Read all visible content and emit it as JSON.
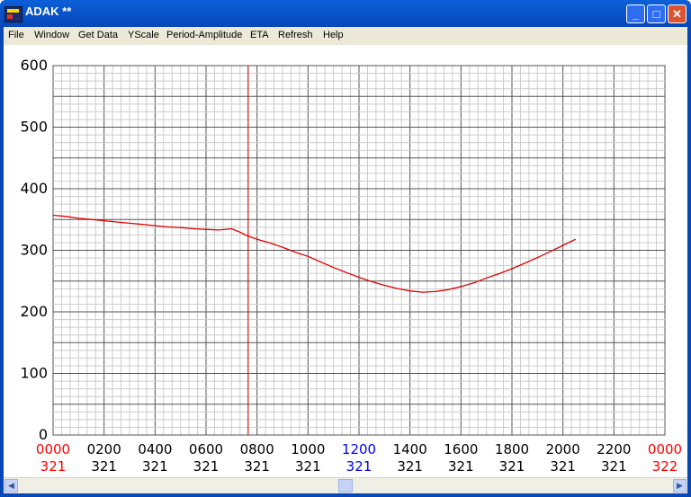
{
  "window": {
    "title": "ADAK **",
    "minimize_label": "_",
    "maximize_label": "□",
    "close_label": "✕"
  },
  "menu": [
    "File",
    "Window",
    "Get Data",
    "YScale",
    "Period-Amplitude",
    "ETA",
    "Refresh",
    "Help"
  ],
  "colors": {
    "titlebar": "#0a5fd8",
    "trace": "#dd0000",
    "cursor": "#dd0000",
    "label_red": "#ff0000",
    "label_blue": "#0000ff",
    "grid_major": "#555555",
    "grid_minor": "#cccccc"
  },
  "chart_data": {
    "type": "line",
    "ylim": [
      0,
      600
    ],
    "ytick_labels": [
      "600",
      "500",
      "400",
      "300",
      "200",
      "100",
      "0"
    ],
    "x_time_labels": [
      {
        "top": "0000",
        "bottom": "321",
        "color": "red"
      },
      {
        "top": "0200",
        "bottom": "321",
        "color": "black"
      },
      {
        "top": "0400",
        "bottom": "321",
        "color": "black"
      },
      {
        "top": "0600",
        "bottom": "321",
        "color": "black"
      },
      {
        "top": "0800",
        "bottom": "321",
        "color": "black"
      },
      {
        "top": "1000",
        "bottom": "321",
        "color": "black"
      },
      {
        "top": "1200",
        "bottom": "321",
        "color": "blue"
      },
      {
        "top": "1400",
        "bottom": "321",
        "color": "black"
      },
      {
        "top": "1600",
        "bottom": "321",
        "color": "black"
      },
      {
        "top": "1800",
        "bottom": "321",
        "color": "black"
      },
      {
        "top": "2000",
        "bottom": "321",
        "color": "black"
      },
      {
        "top": "2200",
        "bottom": "321",
        "color": "black"
      },
      {
        "top": "0000",
        "bottom": "322",
        "color": "red"
      }
    ],
    "x_range_hours": [
      0,
      24
    ],
    "cursor_hour": 7.65,
    "grid": true,
    "series": [
      {
        "x": [
          0,
          0.5,
          1,
          1.5,
          2,
          2.5,
          3,
          3.5,
          4,
          4.5,
          5,
          5.5,
          6,
          6.5,
          7,
          7.3,
          7.6,
          8,
          8.5,
          9,
          9.5,
          10,
          10.5,
          11,
          11.5,
          12,
          12.5,
          13,
          13.5,
          14,
          14.5,
          15,
          15.5,
          16,
          16.5,
          17,
          17.5,
          18,
          18.5,
          19,
          19.5,
          20,
          20.5
        ],
        "y": [
          357,
          355,
          352,
          350,
          348,
          346,
          344,
          342,
          340,
          338,
          337,
          335,
          334,
          333,
          335,
          330,
          324,
          318,
          312,
          305,
          297,
          290,
          281,
          272,
          264,
          256,
          249,
          243,
          238,
          234,
          232,
          233,
          236,
          241,
          247,
          255,
          262,
          270,
          279,
          288,
          298,
          308,
          318
        ]
      }
    ]
  },
  "scrollbar": {
    "left_arrow": "◀",
    "right_arrow": "▶"
  }
}
